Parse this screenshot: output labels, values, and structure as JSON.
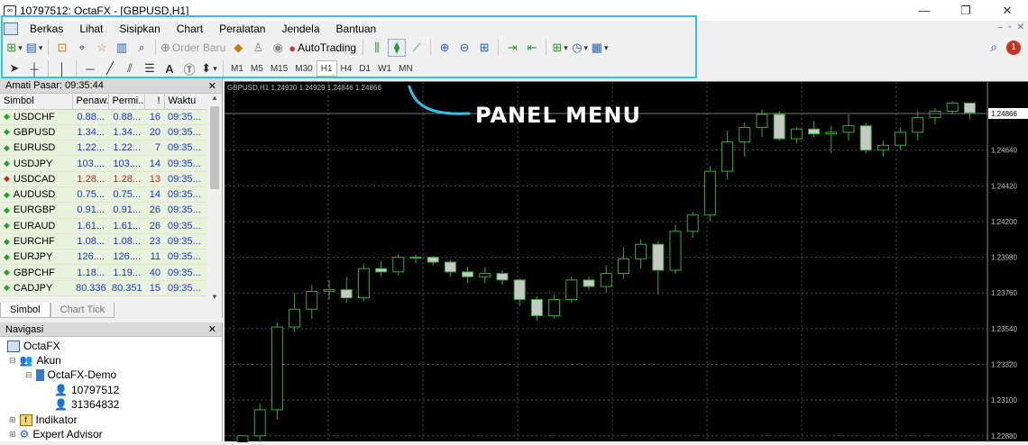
{
  "window": {
    "title": "10797512: OctaFX - [GBPUSD,H1]",
    "minimize": "—",
    "restore": "❐",
    "close": "✕"
  },
  "menubar": {
    "items": [
      "Berkas",
      "Lihat",
      "Sisipkan",
      "Chart",
      "Peralatan",
      "Jendela",
      "Bantuan"
    ]
  },
  "toolbar": {
    "order_baru": "Order Baru",
    "autotrading": "AutoTrading"
  },
  "timeframes": [
    "M1",
    "M5",
    "M15",
    "M30",
    "H1",
    "H4",
    "D1",
    "W1",
    "MN"
  ],
  "active_timeframe": "H1",
  "notification_count": "1",
  "callout": {
    "text": "PANEL MENU",
    "color": "#2fc2e5"
  },
  "market_watch": {
    "title": "Amati Pasar: 09:35:44",
    "columns": [
      "Simbol",
      "Penaw...",
      "Permi...",
      "!",
      "Waktu"
    ],
    "rows": [
      {
        "symbol": "USDCHF",
        "bid": "0.88...",
        "ask": "0.88...",
        "spread": "16",
        "time": "09:35...",
        "dir": "up"
      },
      {
        "symbol": "GBPUSD",
        "bid": "1.34...",
        "ask": "1.34...",
        "spread": "20",
        "time": "09:35...",
        "dir": "up"
      },
      {
        "symbol": "EURUSD",
        "bid": "1.22...",
        "ask": "1.22...",
        "spread": "7",
        "time": "09:35...",
        "dir": "up"
      },
      {
        "symbol": "USDJPY",
        "bid": "103....",
        "ask": "103....",
        "spread": "14",
        "time": "09:35...",
        "dir": "up"
      },
      {
        "symbol": "USDCAD",
        "bid": "1.28...",
        "ask": "1.28...",
        "spread": "13",
        "time": "09:35...",
        "dir": "down"
      },
      {
        "symbol": "AUDUSD",
        "bid": "0.75...",
        "ask": "0.75...",
        "spread": "14",
        "time": "09:35...",
        "dir": "up"
      },
      {
        "symbol": "EURGBP",
        "bid": "0.91...",
        "ask": "0.91...",
        "spread": "26",
        "time": "09:35...",
        "dir": "up"
      },
      {
        "symbol": "EURAUD",
        "bid": "1.61...",
        "ask": "1.61...",
        "spread": "26",
        "time": "09:35...",
        "dir": "up"
      },
      {
        "symbol": "EURCHF",
        "bid": "1.08...",
        "ask": "1.08...",
        "spread": "23",
        "time": "09:35...",
        "dir": "up"
      },
      {
        "symbol": "EURJPY",
        "bid": "126....",
        "ask": "126....",
        "spread": "11",
        "time": "09:35...",
        "dir": "up"
      },
      {
        "symbol": "GBPCHF",
        "bid": "1.18...",
        "ask": "1.19...",
        "spread": "40",
        "time": "09:35...",
        "dir": "up"
      },
      {
        "symbol": "CADJPY",
        "bid": "80.336",
        "ask": "80.351",
        "spread": "15",
        "time": "09:35...",
        "dir": "up"
      }
    ],
    "tabs": [
      "Simbol",
      "Chart Tick"
    ]
  },
  "navigator": {
    "title": "Navigasi",
    "tree": [
      {
        "label": "OctaFX",
        "icon": "broker-icon"
      },
      {
        "label": "Akun",
        "icon": "accounts-icon"
      },
      {
        "label": "OctaFX-Demo",
        "icon": "server-icon"
      },
      {
        "label": "10797512",
        "icon": "account-icon"
      },
      {
        "label": "31364832",
        "icon": "account-icon"
      },
      {
        "label": "Indikator",
        "icon": "indicators-icon"
      },
      {
        "label": "Expert Advisor",
        "icon": "expert-advisor-icon"
      }
    ]
  },
  "chart_data": {
    "type": "candlestick",
    "title": "GBPUSD,H1  1.24920 1.24929 1.24846 1.24866",
    "symbol": "GBPUSD",
    "timeframe": "H1",
    "ohlc_header": [
      "1.24920",
      "1.24929",
      "1.24846",
      "1.24866"
    ],
    "current_price": "1.24866",
    "y_ticks": [
      "1.24640",
      "1.24420",
      "1.24200",
      "1.23980",
      "1.23760",
      "1.23540",
      "1.23320",
      "1.23100",
      "1.22880"
    ],
    "ylim": [
      1.2284,
      1.2506
    ],
    "grid": true,
    "colors": {
      "bull": "#000000",
      "bear": "#c8c8c8",
      "wick": "#2faf2f",
      "grid": "#4a4a4a",
      "text": "#c0c0c0"
    },
    "candles": [
      {
        "o": 1.2282,
        "h": 1.2286,
        "l": 1.2278,
        "c": 1.2288
      },
      {
        "o": 1.2288,
        "h": 1.2308,
        "l": 1.2282,
        "c": 1.2304
      },
      {
        "o": 1.2304,
        "h": 1.2358,
        "l": 1.2298,
        "c": 1.2355
      },
      {
        "o": 1.2355,
        "h": 1.2376,
        "l": 1.2352,
        "c": 1.2366
      },
      {
        "o": 1.2366,
        "h": 1.2381,
        "l": 1.236,
        "c": 1.2377
      },
      {
        "o": 1.2377,
        "h": 1.2384,
        "l": 1.2372,
        "c": 1.2378
      },
      {
        "o": 1.2378,
        "h": 1.2386,
        "l": 1.237,
        "c": 1.2373
      },
      {
        "o": 1.2373,
        "h": 1.2394,
        "l": 1.2371,
        "c": 1.2391
      },
      {
        "o": 1.2391,
        "h": 1.2396,
        "l": 1.2386,
        "c": 1.2389
      },
      {
        "o": 1.2389,
        "h": 1.24,
        "l": 1.2387,
        "c": 1.2398
      },
      {
        "o": 1.2398,
        "h": 1.24,
        "l": 1.2394,
        "c": 1.2398
      },
      {
        "o": 1.2398,
        "h": 1.2399,
        "l": 1.2393,
        "c": 1.2395
      },
      {
        "o": 1.2395,
        "h": 1.2396,
        "l": 1.2386,
        "c": 1.2389
      },
      {
        "o": 1.2389,
        "h": 1.2392,
        "l": 1.2382,
        "c": 1.2386
      },
      {
        "o": 1.2386,
        "h": 1.2392,
        "l": 1.2382,
        "c": 1.2388
      },
      {
        "o": 1.2388,
        "h": 1.239,
        "l": 1.2381,
        "c": 1.2384
      },
      {
        "o": 1.2384,
        "h": 1.2385,
        "l": 1.2368,
        "c": 1.2372
      },
      {
        "o": 1.2372,
        "h": 1.2374,
        "l": 1.2359,
        "c": 1.2362
      },
      {
        "o": 1.2362,
        "h": 1.2375,
        "l": 1.236,
        "c": 1.2372
      },
      {
        "o": 1.2372,
        "h": 1.2386,
        "l": 1.237,
        "c": 1.2384
      },
      {
        "o": 1.2384,
        "h": 1.2386,
        "l": 1.2378,
        "c": 1.238
      },
      {
        "o": 1.238,
        "h": 1.2393,
        "l": 1.2376,
        "c": 1.2388
      },
      {
        "o": 1.2388,
        "h": 1.2404,
        "l": 1.2385,
        "c": 1.2397
      },
      {
        "o": 1.2397,
        "h": 1.2409,
        "l": 1.2391,
        "c": 1.2406
      },
      {
        "o": 1.2406,
        "h": 1.2408,
        "l": 1.2375,
        "c": 1.239
      },
      {
        "o": 1.239,
        "h": 1.2418,
        "l": 1.2388,
        "c": 1.2414
      },
      {
        "o": 1.2414,
        "h": 1.2426,
        "l": 1.241,
        "c": 1.2424
      },
      {
        "o": 1.2424,
        "h": 1.2454,
        "l": 1.242,
        "c": 1.2451
      },
      {
        "o": 1.2451,
        "h": 1.2476,
        "l": 1.2446,
        "c": 1.2469
      },
      {
        "o": 1.2469,
        "h": 1.2481,
        "l": 1.246,
        "c": 1.2478
      },
      {
        "o": 1.2478,
        "h": 1.2489,
        "l": 1.2472,
        "c": 1.2486
      },
      {
        "o": 1.2486,
        "h": 1.2488,
        "l": 1.247,
        "c": 1.2471
      },
      {
        "o": 1.2471,
        "h": 1.2478,
        "l": 1.2468,
        "c": 1.2477
      },
      {
        "o": 1.2477,
        "h": 1.2482,
        "l": 1.2472,
        "c": 1.2474
      },
      {
        "o": 1.2474,
        "h": 1.2479,
        "l": 1.2462,
        "c": 1.2475
      },
      {
        "o": 1.2475,
        "h": 1.2486,
        "l": 1.247,
        "c": 1.2479
      },
      {
        "o": 1.2479,
        "h": 1.2481,
        "l": 1.2462,
        "c": 1.2464
      },
      {
        "o": 1.2464,
        "h": 1.247,
        "l": 1.246,
        "c": 1.2467
      },
      {
        "o": 1.2467,
        "h": 1.2478,
        "l": 1.2464,
        "c": 1.2475
      },
      {
        "o": 1.2475,
        "h": 1.2488,
        "l": 1.247,
        "c": 1.2484
      },
      {
        "o": 1.2484,
        "h": 1.249,
        "l": 1.248,
        "c": 1.2488
      },
      {
        "o": 1.2488,
        "h": 1.2494,
        "l": 1.2486,
        "c": 1.2493
      },
      {
        "o": 1.2493,
        "h": 1.2493,
        "l": 1.2483,
        "c": 1.2487
      }
    ]
  }
}
